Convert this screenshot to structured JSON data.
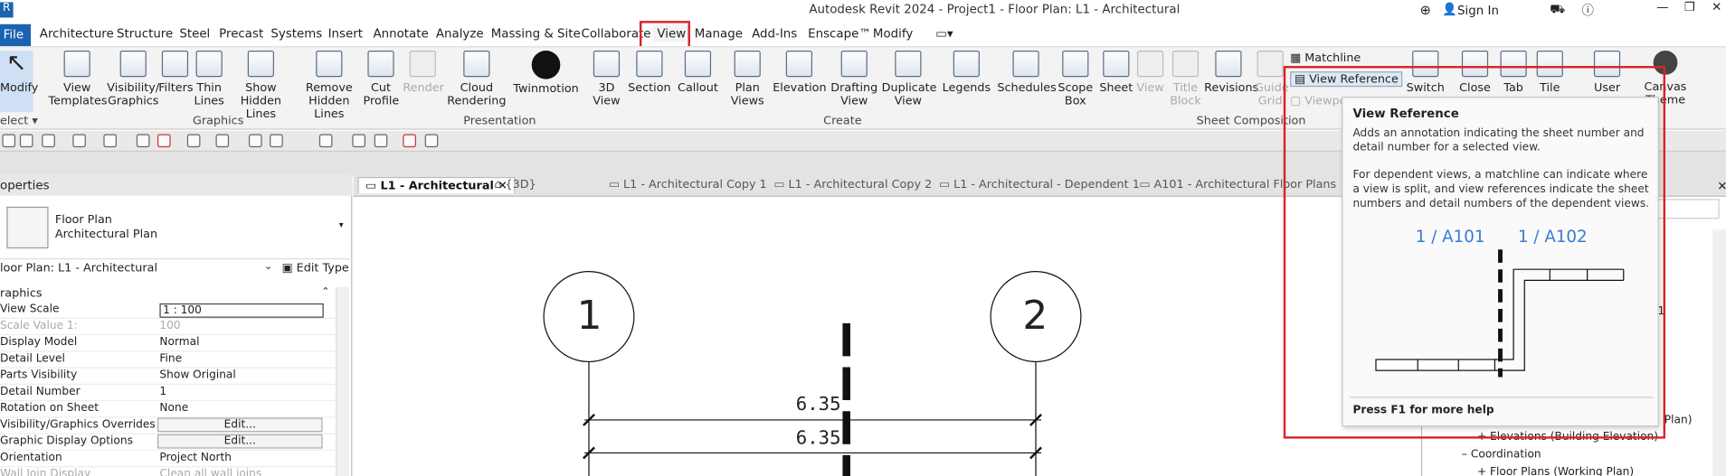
{
  "window": {
    "title": "Autodesk Revit 2024 - Project1 - Floor Plan: L1 - Architectural",
    "sign_in": "Sign In",
    "app_icon": "R"
  },
  "ribbon_tabs": [
    "File",
    "Architecture",
    "Structure",
    "Steel",
    "Precast",
    "Systems",
    "Insert",
    "Annotate",
    "Analyze",
    "Massing & Site",
    "Collaborate",
    "View",
    "Manage",
    "Add-Ins",
    "Enscape™",
    "Modify"
  ],
  "active_tab": "View",
  "ribbon": {
    "select": {
      "modify": "Modify",
      "select": "elect ▾"
    },
    "graphics": {
      "label": "Graphics",
      "buttons": [
        {
          "l1": "View",
          "l2": "Templates"
        },
        {
          "l1": "Visibility/",
          "l2": "Graphics"
        },
        {
          "l1": "Filters",
          "l2": ""
        },
        {
          "l1": "Thin",
          "l2": "Lines"
        },
        {
          "l1": "Show",
          "l2": "Hidden Lines"
        },
        {
          "l1": "Remove",
          "l2": "Hidden Lines"
        },
        {
          "l1": "Cut",
          "l2": "Profile"
        }
      ]
    },
    "presentation": {
      "label": "Presentation",
      "buttons": [
        {
          "l1": "Render",
          "l2": ""
        },
        {
          "l1": "Cloud",
          "l2": "Rendering"
        },
        {
          "l1": "Twinmotion",
          "l2": ""
        }
      ]
    },
    "create": {
      "label": "Create",
      "buttons": [
        {
          "l1": "3D",
          "l2": "View"
        },
        {
          "l1": "Section",
          "l2": ""
        },
        {
          "l1": "Callout",
          "l2": ""
        },
        {
          "l1": "Plan",
          "l2": "Views"
        },
        {
          "l1": "Elevation",
          "l2": ""
        },
        {
          "l1": "Drafting",
          "l2": "View"
        },
        {
          "l1": "Duplicate",
          "l2": "View"
        },
        {
          "l1": "Legends",
          "l2": ""
        },
        {
          "l1": "Schedules",
          "l2": ""
        },
        {
          "l1": "Scope",
          "l2": "Box"
        }
      ]
    },
    "sheet_composition": {
      "label": "Sheet Composition",
      "buttons": [
        {
          "l1": "Sheet",
          "l2": ""
        },
        {
          "l1": "View",
          "l2": ""
        },
        {
          "l1": "Title",
          "l2": "Block"
        },
        {
          "l1": "Revisions",
          "l2": ""
        },
        {
          "l1": "Guide",
          "l2": "Grid"
        }
      ],
      "small": [
        "Matchline",
        "View  Reference",
        "Viewpo"
      ]
    },
    "windows": {
      "buttons": [
        {
          "l1": "Switch",
          "l2": ""
        },
        {
          "l1": "Close",
          "l2": ""
        },
        {
          "l1": "Tab",
          "l2": ""
        },
        {
          "l1": "Tile",
          "l2": ""
        },
        {
          "l1": "User",
          "l2": ""
        },
        {
          "l1": "Canvas",
          "l2": "Theme"
        }
      ]
    }
  },
  "properties": {
    "header": "operties",
    "type_name": "Floor Plan",
    "type_sub": "Architectural Plan",
    "instance": "loor Plan: L1 - Architectural",
    "edit_type": "Edit Type",
    "section": "raphics",
    "rows": [
      {
        "k": "View Scale",
        "v": "1 : 100"
      },
      {
        "k": "Scale Value    1:",
        "v": "100"
      },
      {
        "k": "Display Model",
        "v": "Normal"
      },
      {
        "k": "Detail Level",
        "v": "Fine"
      },
      {
        "k": "Parts Visibility",
        "v": "Show Original"
      },
      {
        "k": "Detail Number",
        "v": "1"
      },
      {
        "k": "Rotation on Sheet",
        "v": "None"
      },
      {
        "k": "Visibility/Graphics Overrides",
        "v": "Edit..."
      },
      {
        "k": "Graphic Display Options",
        "v": "Edit..."
      },
      {
        "k": "Orientation",
        "v": "Project North"
      },
      {
        "k": "Wall Join Display",
        "v": "Clean all wall joins"
      }
    ]
  },
  "view_tabs": [
    "L1 - Architectural",
    "{3D}",
    "L1 - Architectural Copy 1",
    "L1 - Architectural Copy 2",
    "L1 - Architectural - Dependent 1",
    "A101 - Architectural Floor Plans"
  ],
  "canvas": {
    "grid1": "1",
    "grid2": "2",
    "dim1": "6.35",
    "dim2": "6.35"
  },
  "browser": {
    "items": [
      "1",
      "Elevations (Building Elevation)",
      "Coordination",
      "Floor Plans (Working Plan)",
      "Plan)"
    ]
  },
  "tooltip": {
    "title": "View Reference",
    "p1": "Adds an annotation indicating the sheet number and detail number for a selected view.",
    "p2": "For dependent views, a matchline can indicate where a view is split, and view references indicate the sheet numbers and detail numbers of the dependent views.",
    "ref1": "1 / A101",
    "ref2": "1 / A102",
    "help": "Press F1 for more help"
  },
  "colors": {
    "accent": "#1b63b0",
    "highlight": "#d8232a",
    "ref_text": "#3a7bd5"
  }
}
